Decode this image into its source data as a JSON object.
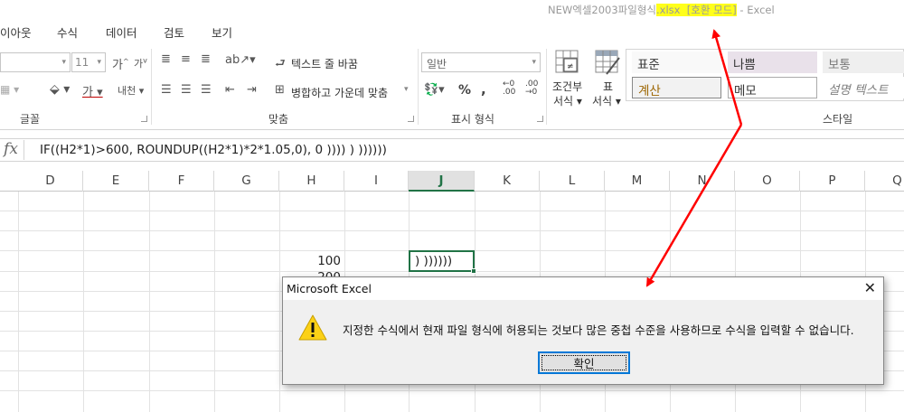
{
  "window": {
    "title_pre": "NEW엑셀2003파일형식",
    "title_ext": ".xlsx",
    "title_gap": "  ",
    "title_mode": "[호환 모드]",
    "title_post": " - Excel"
  },
  "ribbon_tabs": [
    "이아웃",
    "수식",
    "데이터",
    "검토",
    "보기"
  ],
  "ribbon": {
    "font_size": "11",
    "font_grow": "가",
    "font_shrink": "가",
    "underline_glyph": "가",
    "char_spacing": "내천",
    "wrap_text": "텍스트 줄 바꿈",
    "merge_center": "병합하고 가운데 맞춤",
    "number_format": "일반",
    "percent": "%",
    "comma": ",",
    "inc_decimal": "←0\n.00",
    "dec_decimal": ".00\n→0",
    "cond_format_line1": "조건부",
    "cond_format_line2": "서식",
    "table_format_line1": "표",
    "table_format_line2": "서식",
    "groups": {
      "font": "글꼴",
      "alignment": "맞춤",
      "number": "표시 형식",
      "styles": "스타일"
    },
    "cell_styles": [
      {
        "label": "표준",
        "bg": "#f9f9f9",
        "color": "#333"
      },
      {
        "label": "나쁨",
        "bg": "#e9e1ea",
        "color": "#333"
      },
      {
        "label": "보통",
        "bg": "#efefef",
        "color": "#777"
      },
      {
        "label": "계산",
        "bg": "#f2f2f2",
        "color": "#9c6500"
      },
      {
        "label": "메모",
        "bg": "#ffffff",
        "color": "#333"
      },
      {
        "label": "설명 텍스트",
        "bg": "#ffffff",
        "color": "#7f7f7f"
      }
    ]
  },
  "formula_bar": {
    "fx_label": "fx",
    "formula": "IF((H2*1)>600, ROUNDUP((H2*1)*2*1.05,0), 0 )))) ) ))))))"
  },
  "columns": [
    "D",
    "E",
    "F",
    "G",
    "H",
    "I",
    "J",
    "K",
    "L",
    "M",
    "N",
    "O",
    "P",
    "Q"
  ],
  "active_column": "J",
  "cells": {
    "H_value": "100",
    "H_next_value": "200",
    "J_value": ") ))))))"
  },
  "dialog": {
    "title": "Microsoft Excel",
    "message": "지정한 수식에서 현재 파일 형식에 허용되는 것보다 많은 중첩 수준을 사용하므로 수식을 입력할 수 없습니다.",
    "ok_label": "확인",
    "close_glyph": "✕"
  },
  "colors": {
    "highlight": "#ffff1a",
    "excel_green": "#217346",
    "annotation_red": "#ff0000"
  }
}
